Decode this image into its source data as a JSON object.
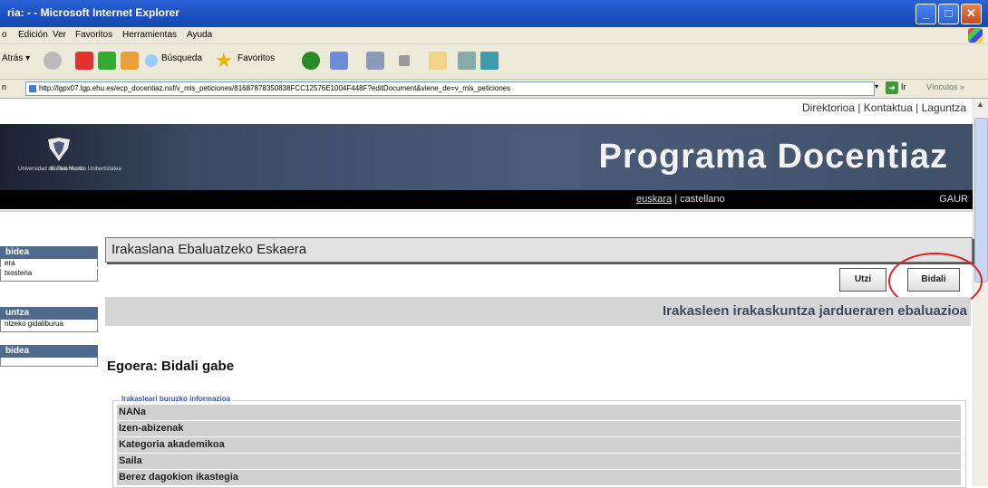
{
  "window": {
    "title": "ria: - - Microsoft Internet Explorer",
    "buttons": [
      "_",
      "□",
      "✕"
    ]
  },
  "menubar": {
    "items": [
      "o",
      "Edición",
      "Ver",
      "Favoritos",
      "Herramientas",
      "Ayuda"
    ]
  },
  "toolbar": {
    "back_label": "Atrás",
    "search_label": "Búsqueda",
    "favorites_label": "Favoritos"
  },
  "addressbar": {
    "prefix": "n",
    "url": "http://lgpx07.lgp.ehu.es/ecp_docentiaz.nsf/v_mis_peticiones/81687878350838FCC12576E1004F448F?editDocument&viene_de=v_mis_peticiones",
    "go_label": "Ir",
    "links_label": "Vínculos »"
  },
  "page": {
    "topnav": "Direktorioa | Kontaktua | Laguntza",
    "logo_text_left": "Universidad del País Vasco",
    "logo_text_right": "Euskal Herriko Unibertsitatea",
    "title": "Programa Docentiaz",
    "lang_euskara": "euskara",
    "lang_sep": " | ",
    "lang_castellano": "castellano",
    "gaur": "GAUR"
  },
  "sidebar": {
    "sections": [
      {
        "header": "bidea",
        "items": [
          "era",
          "txostena"
        ]
      },
      {
        "header": "untza",
        "items": [
          "ntzeko gidaliburua"
        ]
      },
      {
        "header": "bidea",
        "items": []
      }
    ]
  },
  "main": {
    "heading": "Irakaslana Ebaluatzeko Eskaera",
    "btn_cancel": "Utzi",
    "btn_send": "Bidali",
    "section_title": "Irakasleen irakaskuntza jardueraren ebaluazioa",
    "status": "Egoera: Bidali gabe",
    "info_legend": "Irakasleari buruzko informazioa",
    "info_rows": [
      "NANa",
      "Izen-abizenak",
      "Kategoria akademikoa",
      "Saila",
      "Berez dagokion ikastegia"
    ]
  },
  "colors": {
    "titlebar": "#1b4fc0",
    "banner": "#4a5c78",
    "highlight_circle": "#e02020"
  }
}
